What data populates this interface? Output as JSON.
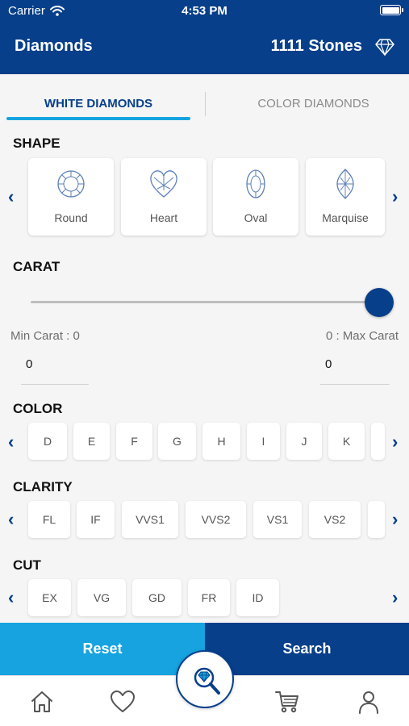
{
  "status_bar": {
    "carrier": "Carrier",
    "time": "4:53 PM"
  },
  "header": {
    "title": "Diamonds",
    "stones": "1111 Stones"
  },
  "tabs": [
    {
      "label": "WHITE DIAMONDS",
      "active": true
    },
    {
      "label": "COLOR DIAMONDS",
      "active": false
    }
  ],
  "shape": {
    "title": "SHAPE",
    "items": [
      {
        "label": "Round",
        "icon": "round-diamond-icon"
      },
      {
        "label": "Heart",
        "icon": "heart-diamond-icon"
      },
      {
        "label": "Oval",
        "icon": "oval-diamond-icon"
      },
      {
        "label": "Marquise",
        "icon": "marquise-diamond-icon"
      }
    ]
  },
  "carat": {
    "title": "CARAT",
    "min_label": "Min Carat : 0",
    "max_label": "0 : Max Carat",
    "min_value": "0",
    "max_value": "0",
    "slider_position": 1.0
  },
  "color": {
    "title": "COLOR",
    "items": [
      "D",
      "E",
      "F",
      "G",
      "H",
      "I",
      "J",
      "K"
    ]
  },
  "clarity": {
    "title": "CLARITY",
    "items": [
      "FL",
      "IF",
      "VVS1",
      "VVS2",
      "VS1",
      "VS2"
    ]
  },
  "cut": {
    "title": "CUT",
    "items": [
      "EX",
      "VG",
      "GD",
      "FR",
      "ID"
    ]
  },
  "buttons": {
    "reset": "Reset",
    "search": "Search"
  },
  "colors": {
    "primary": "#073f8a",
    "accent": "#16a3df",
    "background": "#f5f5f5"
  }
}
